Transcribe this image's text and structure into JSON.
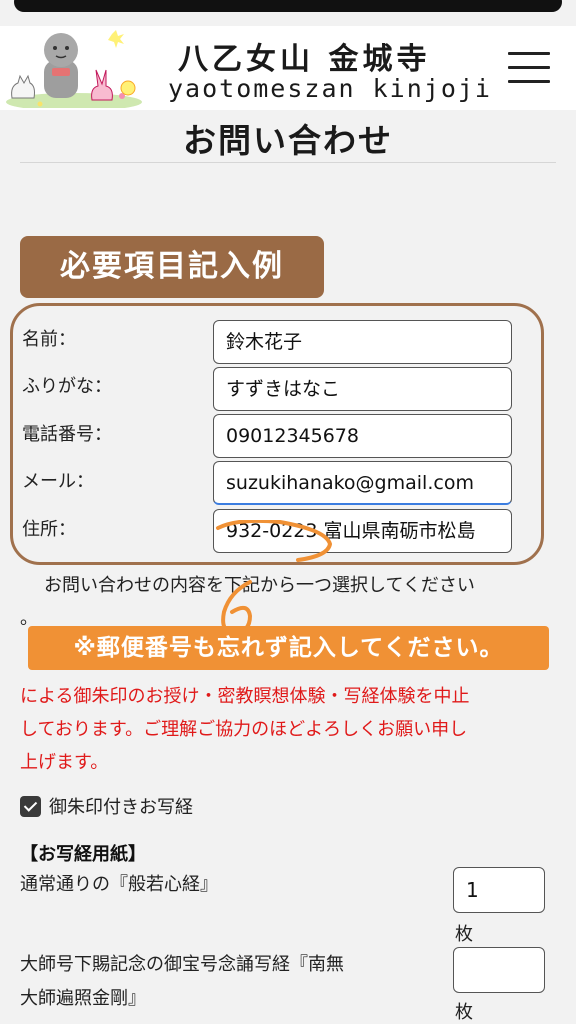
{
  "site": {
    "name_ja": "八乙女山 金城寺",
    "name_en": "yaotomeszan kinjoji"
  },
  "page": {
    "title": "お問い合わせ"
  },
  "example_badge": "必要項目記入例",
  "form": {
    "fields": [
      {
        "label": "名前：",
        "value": "鈴木花子"
      },
      {
        "label": "ふりがな：",
        "value": "すずきはなこ"
      },
      {
        "label": "電話番号：",
        "value": "09012345678"
      },
      {
        "label": "メール：",
        "value": "suzukihanako@gmail.com"
      },
      {
        "label": "住所：",
        "value": "932-0223 富山県南砺市松島"
      }
    ]
  },
  "instruction": "お問い合わせの内容を下記から一つ選択してください",
  "instruction_dot": "。",
  "zip_note": "※郵便番号も忘れず記入してください。",
  "notice_lines": [
    "による御朱印のお授け・密教瞑想体験・写経体験を中止",
    "しております。ご理解ご協力のほどよろしくお願い申し",
    "上げます。"
  ],
  "option": {
    "label": "御朱印付きお写経",
    "checked": true
  },
  "paper_section": {
    "heading": "【お写経用紙】",
    "items": [
      {
        "label": "通常通りの『般若心経』",
        "qty": "1",
        "unit": "枚"
      },
      {
        "label_lines": [
          "大師号下賜記念の御宝号念誦写経『南無",
          "大師遍照金剛』"
        ],
        "qty": "",
        "unit": "枚"
      }
    ]
  },
  "colors": {
    "badge_brown": "#9a6a45",
    "frame_brown": "#a0714d",
    "note_orange": "#f09135",
    "notice_red": "#e01a1a"
  }
}
